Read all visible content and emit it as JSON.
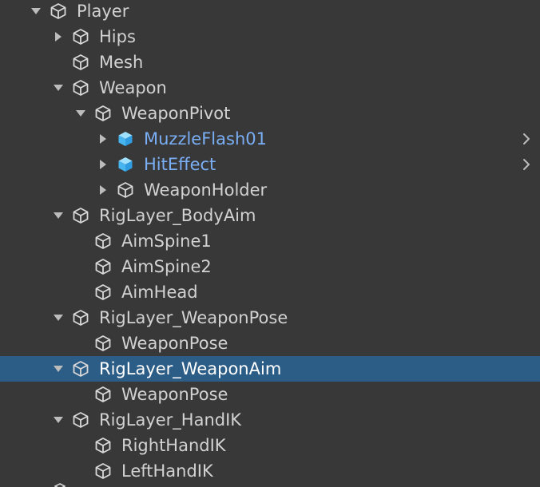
{
  "hierarchy": {
    "selected_color": "#2c5d87",
    "text_color": "#d2d2d2",
    "prefab_text_color": "#7aaef5",
    "rows": [
      {
        "label": "Player",
        "depth": 0,
        "arrow": "expanded",
        "icon": "gameobject-cube-icon"
      },
      {
        "label": "Hips",
        "depth": 1,
        "arrow": "collapsed",
        "icon": "gameobject-cube-icon"
      },
      {
        "label": "Mesh",
        "depth": 1,
        "arrow": "none",
        "icon": "gameobject-cube-icon"
      },
      {
        "label": "Weapon",
        "depth": 1,
        "arrow": "expanded",
        "icon": "gameobject-cube-icon"
      },
      {
        "label": "WeaponPivot",
        "depth": 2,
        "arrow": "expanded",
        "icon": "gameobject-cube-icon"
      },
      {
        "label": "MuzzleFlash01",
        "depth": 3,
        "arrow": "collapsed",
        "icon": "prefab-cube-icon",
        "prefab": true,
        "chevron": "chevron-right-icon"
      },
      {
        "label": "HitEffect",
        "depth": 3,
        "arrow": "collapsed",
        "icon": "prefab-cube-icon",
        "prefab": true,
        "chevron": "chevron-right-icon"
      },
      {
        "label": "WeaponHolder",
        "depth": 3,
        "arrow": "collapsed",
        "icon": "gameobject-cube-icon"
      },
      {
        "label": "RigLayer_BodyAim",
        "depth": 1,
        "arrow": "expanded",
        "icon": "gameobject-cube-icon"
      },
      {
        "label": "AimSpine1",
        "depth": 2,
        "arrow": "none",
        "icon": "gameobject-cube-icon"
      },
      {
        "label": "AimSpine2",
        "depth": 2,
        "arrow": "none",
        "icon": "gameobject-cube-icon"
      },
      {
        "label": "AimHead",
        "depth": 2,
        "arrow": "none",
        "icon": "gameobject-cube-icon"
      },
      {
        "label": "RigLayer_WeaponPose",
        "depth": 1,
        "arrow": "expanded",
        "icon": "gameobject-cube-icon"
      },
      {
        "label": "WeaponPose",
        "depth": 2,
        "arrow": "none",
        "icon": "gameobject-cube-icon"
      },
      {
        "label": "RigLayer_WeaponAim",
        "depth": 1,
        "arrow": "expanded",
        "icon": "gameobject-cube-icon",
        "selected": true
      },
      {
        "label": "WeaponPose",
        "depth": 2,
        "arrow": "none",
        "icon": "gameobject-cube-icon"
      },
      {
        "label": "RigLayer_HandIK",
        "depth": 1,
        "arrow": "expanded",
        "icon": "gameobject-cube-icon"
      },
      {
        "label": "RightHandIK",
        "depth": 2,
        "arrow": "none",
        "icon": "gameobject-cube-icon"
      },
      {
        "label": "LeftHandIK",
        "depth": 2,
        "arrow": "none",
        "icon": "gameobject-cube-icon"
      }
    ]
  }
}
